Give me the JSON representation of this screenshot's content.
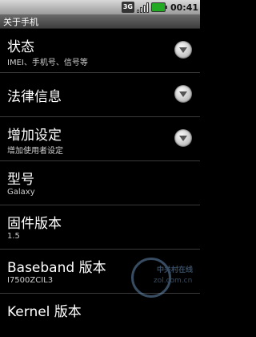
{
  "status_bar": {
    "network": "3G",
    "time": "00:41"
  },
  "title_bar": {
    "title": "关于手机"
  },
  "items": [
    {
      "title": "状态",
      "subtitle": "IMEI、手机号、信号等",
      "has_chevron": true
    },
    {
      "title": "法律信息",
      "subtitle": "",
      "has_chevron": true
    },
    {
      "title": "增加设定",
      "subtitle": "增加使用者设定",
      "has_chevron": true
    },
    {
      "title": "型号",
      "subtitle": "Galaxy",
      "has_chevron": false
    },
    {
      "title": "固件版本",
      "subtitle": "1.5",
      "has_chevron": false
    },
    {
      "title": "Baseband 版本",
      "subtitle": "I7500ZCIL3",
      "has_chevron": false
    },
    {
      "title": "Kernel 版本",
      "subtitle": "",
      "has_chevron": false
    }
  ],
  "watermark": {
    "brand": "中关村在线",
    "url": "zol.com.cn"
  }
}
